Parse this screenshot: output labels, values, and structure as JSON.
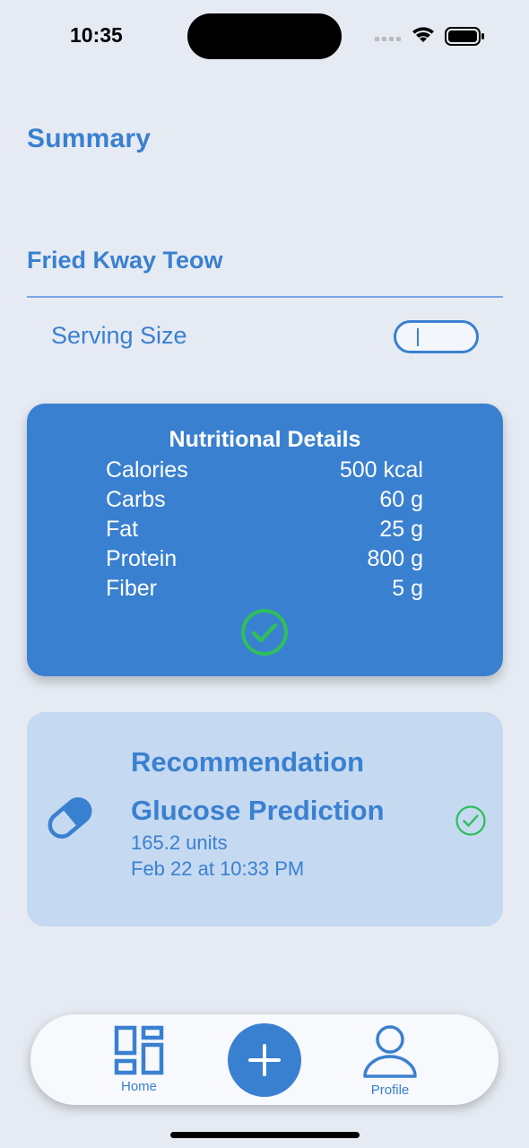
{
  "status_bar": {
    "time": "10:35",
    "icons": [
      "signal-icon",
      "wifi-icon",
      "battery-icon"
    ]
  },
  "header": {
    "title": "Summary"
  },
  "food": {
    "name": "Fried Kway Teow",
    "serving_label": "Serving Size",
    "serving_value": ""
  },
  "nutrition": {
    "title": "Nutritional Details",
    "rows": [
      {
        "label": "Calories",
        "value": "500 kcal"
      },
      {
        "label": "Carbs",
        "value": "60 g"
      },
      {
        "label": "Fat",
        "value": "25 g"
      },
      {
        "label": "Protein",
        "value": "800 g"
      },
      {
        "label": "Fiber",
        "value": "5 g"
      }
    ],
    "status_icon": "check-circle-icon"
  },
  "recommendation": {
    "title": "Recommendation",
    "icon": "pill-icon",
    "prediction_title": "Glucose Prediction",
    "prediction_value": "165.2 units",
    "prediction_time": "Feb 22 at 10:33 PM",
    "status_icon": "check-circle-icon"
  },
  "tab_bar": {
    "home_label": "Home",
    "profile_label": "Profile"
  },
  "colors": {
    "accent": "#3a80d0",
    "background": "#e6ebf3",
    "card_light": "#c5d9f1",
    "success": "#2fbf5a"
  }
}
